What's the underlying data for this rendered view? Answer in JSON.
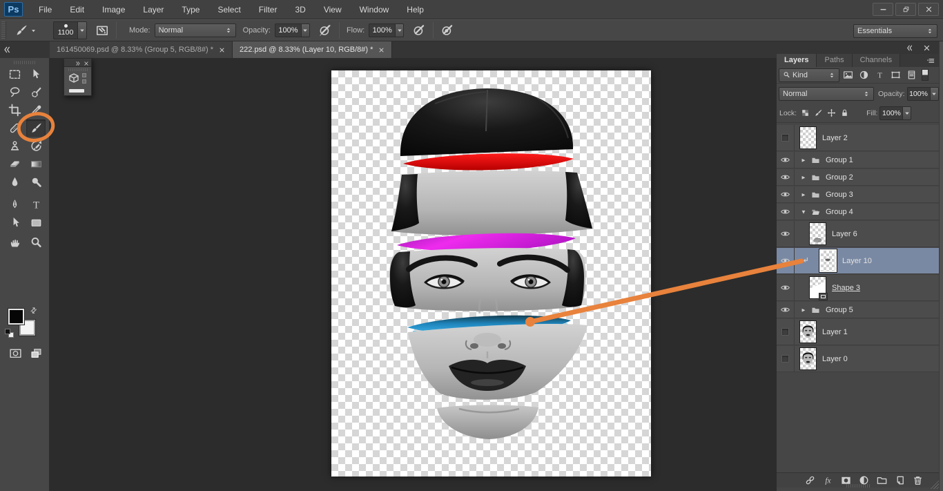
{
  "app": {
    "logo_text": "Ps"
  },
  "menu_bar": {
    "items": [
      "File",
      "Edit",
      "Image",
      "Layer",
      "Type",
      "Select",
      "Filter",
      "3D",
      "View",
      "Window",
      "Help"
    ]
  },
  "window_controls": [
    "minimize-icon",
    "restore-icon",
    "close-icon"
  ],
  "options_bar": {
    "tool_icon": "brush-icon",
    "brush_size": "1100",
    "preset_toggle_icon": "brush-presets-panel-icon",
    "mode_label": "Mode:",
    "mode_value": "Normal",
    "opacity_label": "Opacity:",
    "opacity_value": "100%",
    "tablet_opacity_icon": "tablet-pressure-opacity-icon",
    "flow_label": "Flow:",
    "flow_value": "100%",
    "airbrush_icon": "airbrush-icon",
    "workspace_value": "Essentials"
  },
  "document_tabs": [
    {
      "title": "161450069.psd @ 8.33% (Group 5, RGB/8#) *",
      "active": false
    },
    {
      "title": "222.psd @ 8.33% (Layer 10, RGB/8#) *",
      "active": true
    }
  ],
  "toolbar": {
    "tools": [
      {
        "name": "rectangular-marquee-tool"
      },
      {
        "name": "move-tool"
      },
      {
        "name": "lasso-tool"
      },
      {
        "name": "quick-selection-tool"
      },
      {
        "name": "crop-tool"
      },
      {
        "name": "eyedropper-tool"
      },
      {
        "name": "spot-healing-brush-tool"
      },
      {
        "name": "brush-tool",
        "pressed": true
      },
      {
        "name": "clone-stamp-tool"
      },
      {
        "name": "history-brush-tool"
      },
      {
        "name": "eraser-tool"
      },
      {
        "name": "gradient-tool"
      },
      {
        "name": "blur-tool"
      },
      {
        "name": "dodge-tool"
      },
      {
        "name": "pen-tool"
      },
      {
        "name": "type-tool"
      },
      {
        "name": "path-selection-tool"
      },
      {
        "name": "shape-tool"
      },
      {
        "name": "hand-tool"
      },
      {
        "name": "zoom-tool"
      }
    ],
    "foreground_color": "#060606",
    "background_color": "#f4f4f4",
    "bottom_buttons": [
      "quick-mask-icon",
      "screen-mode-icon"
    ]
  },
  "mini_panel": {
    "icon": "3d-cube-icon"
  },
  "layers_panel": {
    "tabs": [
      {
        "label": "Layers",
        "active": true
      },
      {
        "label": "Paths",
        "active": false
      },
      {
        "label": "Channels",
        "active": false
      }
    ],
    "filter_label": "Kind",
    "filter_icons": [
      "pixel-layer-filter-icon",
      "adjustment-layer-filter-icon",
      "type-layer-filter-icon",
      "shape-layer-filter-icon",
      "smart-object-filter-icon"
    ],
    "blend_mode": "Normal",
    "opacity_label": "Opacity:",
    "opacity_value": "100%",
    "lock_label": "Lock:",
    "lock_icons": [
      "lock-transparency-icon",
      "lock-paint-icon",
      "lock-position-icon",
      "lock-all-icon"
    ],
    "fill_label": "Fill:",
    "fill_value": "100%",
    "layers": [
      {
        "name": "Layer 2",
        "type": "layer",
        "visible": false,
        "thumb": "checker"
      },
      {
        "name": "Group 1",
        "type": "group",
        "visible": true,
        "expanded": false
      },
      {
        "name": "Group 2",
        "type": "group",
        "visible": true,
        "expanded": false
      },
      {
        "name": "Group 3",
        "type": "group",
        "visible": true,
        "expanded": false
      },
      {
        "name": "Group 4",
        "type": "group",
        "visible": true,
        "expanded": true
      },
      {
        "name": "Layer 6",
        "type": "layer",
        "visible": true,
        "indent": 1,
        "thumb": "checker-chin"
      },
      {
        "name": "Layer 10",
        "type": "layer",
        "visible": true,
        "indent": 1,
        "clipped": true,
        "selected": true,
        "thumb": "checker-smudge"
      },
      {
        "name": "Shape 3",
        "type": "layer",
        "visible": true,
        "indent": 1,
        "underlined": true,
        "thumb": "shape"
      },
      {
        "name": "Group 5",
        "type": "group",
        "visible": true,
        "expanded": false
      },
      {
        "name": "Layer 1",
        "type": "layer",
        "visible": false,
        "thumb": "face"
      },
      {
        "name": "Layer 0",
        "type": "layer",
        "visible": false,
        "thumb": "face"
      }
    ],
    "footer_icons": [
      "link-layers-icon",
      "layer-style-fx-icon",
      "add-layer-mask-icon",
      "new-adjustment-layer-icon",
      "new-group-icon",
      "new-layer-icon",
      "delete-layer-icon"
    ]
  },
  "artwork": {
    "band_red": "#e30505",
    "band_magenta": "#dc22dc",
    "band_blue": "#2191cd"
  },
  "colors": {
    "annotation_orange": "#E8823C",
    "layer_selection_blue": "#7a89a3"
  }
}
